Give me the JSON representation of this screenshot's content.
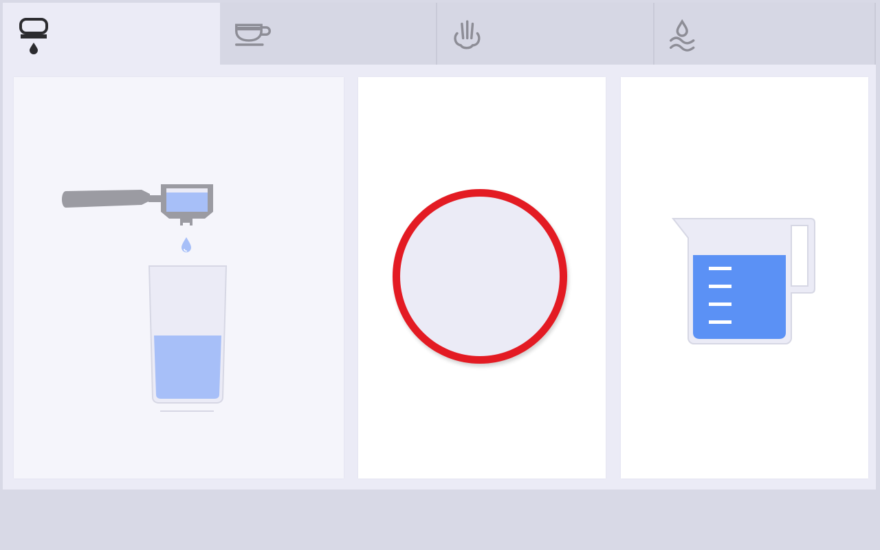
{
  "tabs": [
    {
      "id": "espresso",
      "icon": "espresso-drip-icon",
      "label": "",
      "active": true
    },
    {
      "id": "cup",
      "icon": "coffee-cup-icon",
      "label": "",
      "active": false
    },
    {
      "id": "steam",
      "icon": "steam-wand-icon",
      "label": "",
      "active": false
    },
    {
      "id": "hot-water",
      "icon": "hot-water-icon",
      "label": "",
      "active": false
    }
  ],
  "cards": {
    "brew": {
      "icon": "portafilter-glass-icon",
      "glass_fill_level": 0.5
    },
    "start": {
      "label": "",
      "ring_color": "#e31b23"
    },
    "water": {
      "icon": "measuring-jug-icon",
      "jug_fill_level": 0.7
    }
  },
  "colors": {
    "accent_blue": "#5b91f5",
    "light_blue": "#a7bff8",
    "icon_gray": "#8d8d96",
    "stop_red": "#e31b23",
    "active_tab": "#ebebf6",
    "inactive_tab": "#d6d7e4"
  }
}
